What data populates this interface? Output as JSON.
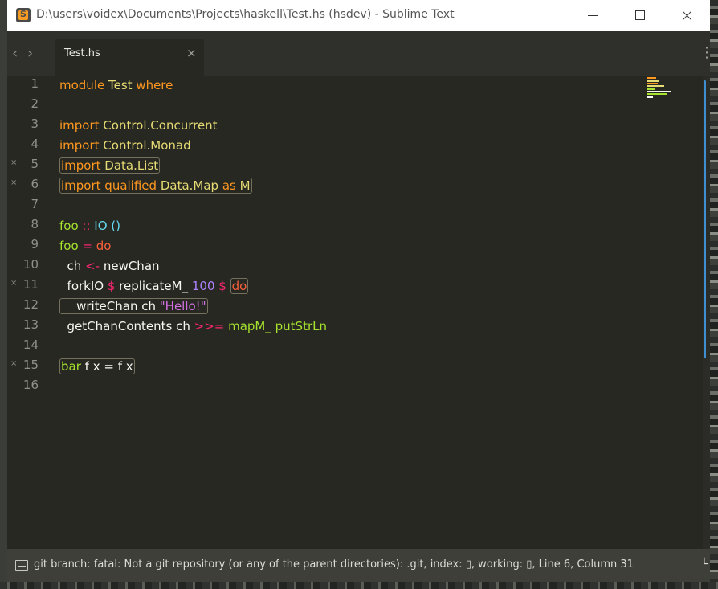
{
  "window": {
    "title": "D:\\users\\voidex\\Documents\\Projects\\haskell\\Test.hs (hsdev) - Sublime Text",
    "app_icon_letter": "S"
  },
  "tabs": {
    "nav_back": "‹",
    "nav_forward": "›",
    "active_tab": "Test.hs",
    "close_glyph": "×",
    "more_glyph": "⋮"
  },
  "editor": {
    "lines": [
      {
        "num": "1",
        "mark": ""
      },
      {
        "num": "2",
        "mark": ""
      },
      {
        "num": "3",
        "mark": ""
      },
      {
        "num": "4",
        "mark": ""
      },
      {
        "num": "5",
        "mark": "×"
      },
      {
        "num": "6",
        "mark": "×"
      },
      {
        "num": "7",
        "mark": ""
      },
      {
        "num": "8",
        "mark": ""
      },
      {
        "num": "9",
        "mark": ""
      },
      {
        "num": "10",
        "mark": ""
      },
      {
        "num": "11",
        "mark": "×"
      },
      {
        "num": "12",
        "mark": ""
      },
      {
        "num": "13",
        "mark": ""
      },
      {
        "num": "14",
        "mark": ""
      },
      {
        "num": "15",
        "mark": "×"
      },
      {
        "num": "16",
        "mark": ""
      }
    ],
    "code": {
      "l1_module": "module",
      "l1_name": " Test ",
      "l1_where": "where",
      "l3_import": "import",
      "l3_mod": " Control.Concurrent",
      "l4_import": "import",
      "l4_mod": " Control.Monad",
      "l5_import": "import",
      "l5_mod": " Data.List",
      "l6_import": "import",
      "l6_qualified": " qualified",
      "l6_mod": " Data.Map",
      "l6_as": " as",
      "l6_alias": " M",
      "l8_name": "foo",
      "l8_sig": " :: ",
      "l8_type": "IO ()",
      "l9_name": "foo",
      "l9_eq": " = ",
      "l9_do": "do",
      "l10_indent": "  ",
      "l10_var": "ch ",
      "l10_arrow": "<-",
      "l10_fn": " newChan",
      "l11_indent": "  ",
      "l11_fn": "forkIO ",
      "l11_op1": "$",
      "l11_fn2": " replicateM_ ",
      "l11_num": "100",
      "l11_op2": " $ ",
      "l11_do": "do",
      "l12_indent": "    ",
      "l12_fn": "writeChan ch ",
      "l12_str": "\"Hello!\"",
      "l13_indent": "  ",
      "l13_fn": "getChanContents ch ",
      "l13_op": ">>=",
      "l13_rest": " mapM_ putStrLn",
      "l15_name": "bar",
      "l15_rest": " f x = f x"
    }
  },
  "status": {
    "text": "git branch: fatal: Not a git repository (or any of the parent directories): .git, index: ▯, working: ▯, Line 6, Column 31",
    "right_glyph": "└"
  }
}
